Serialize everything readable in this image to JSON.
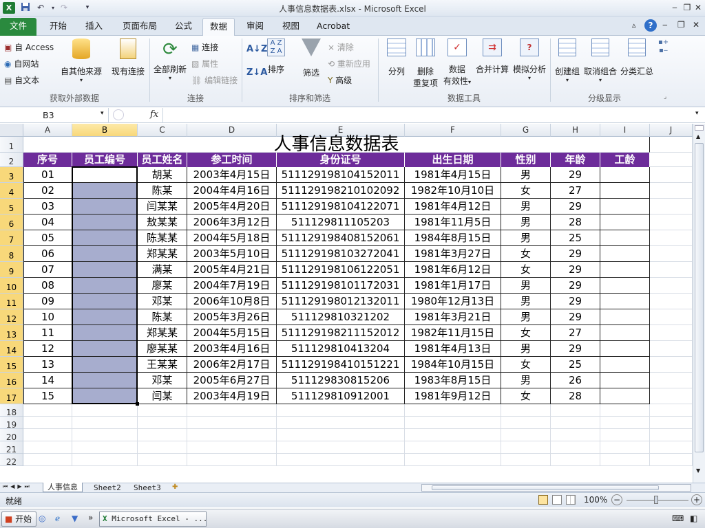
{
  "window": {
    "title": "人事信息数据表.xlsx - Microsoft Excel"
  },
  "tabs": [
    {
      "label": "文件"
    },
    {
      "label": "开始"
    },
    {
      "label": "插入"
    },
    {
      "label": "页面布局"
    },
    {
      "label": "公式"
    },
    {
      "label": "数据"
    },
    {
      "label": "审阅"
    },
    {
      "label": "视图"
    },
    {
      "label": "Acrobat"
    }
  ],
  "active_tab": "数据",
  "ribbon": {
    "get_external": {
      "access": "自 Access",
      "web": "自网站",
      "text": "自文本",
      "other": "自其他来源",
      "existing": "现有连接",
      "label": "获取外部数据"
    },
    "connections": {
      "refresh_all": "全部刷新",
      "connections": "连接",
      "properties": "属性",
      "edit_links": "编辑链接",
      "label": "连接"
    },
    "sort_filter": {
      "sort": "排序",
      "filter": "筛选",
      "clear": "清除",
      "reapply": "重新应用",
      "advanced": "高级",
      "label": "排序和筛选"
    },
    "data_tools": {
      "split": "分列",
      "remove_dup_1": "删除",
      "remove_dup_2": "重复项",
      "validation_1": "数据",
      "validation_2": "有效性",
      "consolidate": "合并计算",
      "whatif": "模拟分析",
      "label": "数据工具"
    },
    "outline": {
      "group": "创建组",
      "ungroup": "取消组合",
      "subtotal": "分类汇总",
      "label": "分级显示"
    }
  },
  "formula_bar": {
    "name_box": "B3",
    "fx": "fx",
    "content": ""
  },
  "columns": [
    "A",
    "B",
    "C",
    "D",
    "E",
    "F",
    "G",
    "H",
    "I",
    "J"
  ],
  "rows": [
    "1",
    "2",
    "3",
    "4",
    "5",
    "6",
    "7",
    "8",
    "9",
    "10",
    "11",
    "12",
    "13",
    "14",
    "15",
    "16",
    "17",
    "18",
    "19",
    "20",
    "21",
    "22"
  ],
  "sheet": {
    "title": "人事信息数据表",
    "headers": [
      "序号",
      "员工编号",
      "员工姓名",
      "参工时间",
      "身份证号",
      "出生日期",
      "性别",
      "年龄",
      "工龄"
    ],
    "records": [
      [
        "01",
        "",
        "胡某",
        "2003年4月15日",
        "511129198104152011",
        "1981年4月15日",
        "男",
        "29",
        ""
      ],
      [
        "02",
        "",
        "陈某",
        "2004年4月16日",
        "511129198210102092",
        "1982年10月10日",
        "女",
        "27",
        ""
      ],
      [
        "03",
        "",
        "闫某某",
        "2005年4月20日",
        "511129198104122071",
        "1981年4月12日",
        "男",
        "29",
        ""
      ],
      [
        "04",
        "",
        "敖某某",
        "2006年3月12日",
        "511129811105203",
        "1981年11月5日",
        "男",
        "28",
        ""
      ],
      [
        "05",
        "",
        "陈某某",
        "2004年5月18日",
        "511129198408152061",
        "1984年8月15日",
        "男",
        "25",
        ""
      ],
      [
        "06",
        "",
        "郑某某",
        "2003年5月10日",
        "511129198103272041",
        "1981年3月27日",
        "女",
        "29",
        ""
      ],
      [
        "07",
        "",
        "满某",
        "2005年4月21日",
        "511129198106122051",
        "1981年6月12日",
        "女",
        "29",
        ""
      ],
      [
        "08",
        "",
        "廖某",
        "2004年7月19日",
        "511129198101172031",
        "1981年1月17日",
        "男",
        "29",
        ""
      ],
      [
        "09",
        "",
        "邓某",
        "2006年10月8日",
        "511129198012132011",
        "1980年12月13日",
        "男",
        "29",
        ""
      ],
      [
        "10",
        "",
        "陈某",
        "2005年3月26日",
        "511129810321202",
        "1981年3月21日",
        "男",
        "29",
        ""
      ],
      [
        "11",
        "",
        "郑某某",
        "2004年5月15日",
        "511129198211152012",
        "1982年11月15日",
        "女",
        "27",
        ""
      ],
      [
        "12",
        "",
        "廖某某",
        "2003年4月16日",
        "511129810413204",
        "1981年4月13日",
        "男",
        "29",
        ""
      ],
      [
        "13",
        "",
        "王某某",
        "2006年2月17日",
        "511129198410151221",
        "1984年10月15日",
        "女",
        "25",
        ""
      ],
      [
        "14",
        "",
        "邓某",
        "2005年6月27日",
        "511129830815206",
        "1983年8月15日",
        "男",
        "26",
        ""
      ],
      [
        "15",
        "",
        "闫某",
        "2003年4月19日",
        "511129810912001",
        "1981年9月12日",
        "女",
        "28",
        ""
      ]
    ]
  },
  "sheet_tabs": [
    {
      "label": "人事信息"
    },
    {
      "label": "Sheet2"
    },
    {
      "label": "Sheet3"
    }
  ],
  "status": {
    "ready": "就绪",
    "zoom": "100%"
  },
  "taskbar": {
    "start": "开始",
    "app": "Microsoft Excel - ..."
  },
  "colors": {
    "header_bg": "#6d2c9a",
    "selection_fill": "#a7adce",
    "file_tab": "#2a8a3e"
  }
}
